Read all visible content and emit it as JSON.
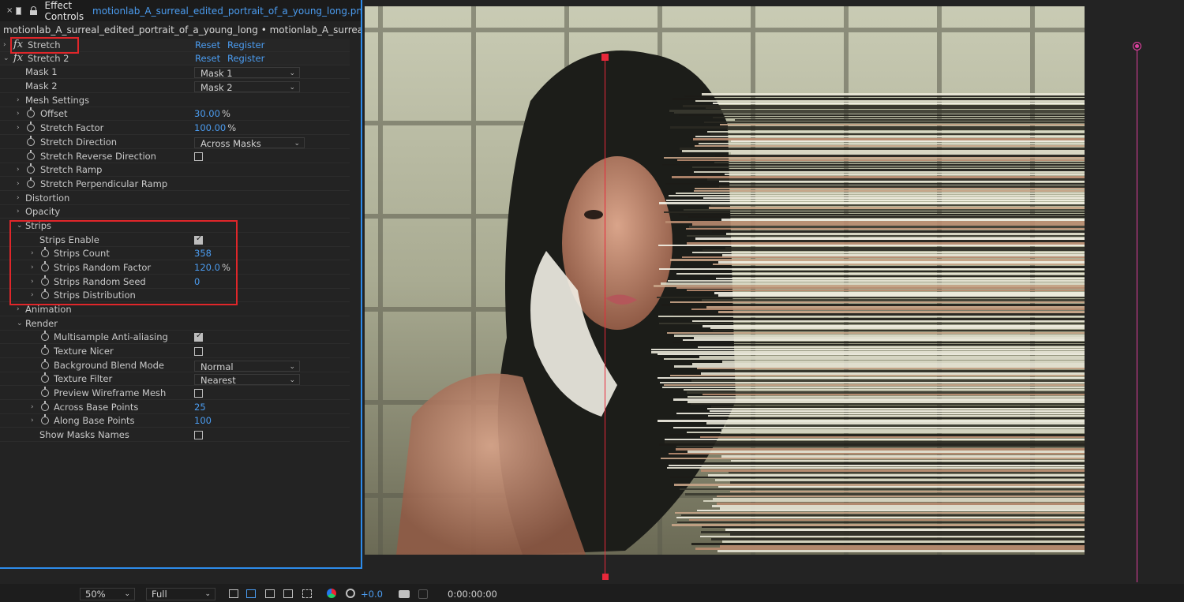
{
  "tab": {
    "close_glyph": "×",
    "title": "Effect Controls",
    "file": "motionlab_A_surreal_edited_portrait_of_a_young_long.pn"
  },
  "breadcrumb": "motionlab_A_surreal_edited_portrait_of_a_young_long • motionlab_A_surreal_edited_po",
  "effects": [
    {
      "name": "Stretch",
      "reset": "Reset",
      "register": "Register"
    },
    {
      "name": "Stretch 2",
      "reset": "Reset",
      "register": "Register"
    }
  ],
  "props": {
    "mask1": {
      "label": "Mask 1",
      "value": "Mask 1"
    },
    "mask2": {
      "label": "Mask 2",
      "value": "Mask 2"
    },
    "mesh_settings": "Mesh Settings",
    "offset": {
      "label": "Offset",
      "value": "30.00",
      "unit": "%"
    },
    "stretch_factor": {
      "label": "Stretch Factor",
      "value": "100.00",
      "unit": "%"
    },
    "stretch_direction": {
      "label": "Stretch Direction",
      "value": "Across Masks"
    },
    "stretch_reverse": {
      "label": "Stretch Reverse Direction",
      "checked": false
    },
    "stretch_ramp": "Stretch Ramp",
    "stretch_perp_ramp": "Stretch Perpendicular Ramp",
    "distortion": "Distortion",
    "opacity": "Opacity",
    "strips": "Strips",
    "strips_enable": {
      "label": "Strips Enable",
      "checked": true
    },
    "strips_count": {
      "label": "Strips Count",
      "value": "358"
    },
    "strips_random_factor": {
      "label": "Strips Random Factor",
      "value": "120.0",
      "unit": "%"
    },
    "strips_random_seed": {
      "label": "Strips Random Seed",
      "value": "0"
    },
    "strips_distribution": "Strips Distribution",
    "animation": "Animation",
    "render": "Render",
    "multisample": {
      "label": "Multisample Anti-aliasing",
      "checked": true
    },
    "texture_nicer": {
      "label": "Texture Nicer",
      "checked": false
    },
    "bg_blend": {
      "label": "Background Blend Mode",
      "value": "Normal"
    },
    "texture_filter": {
      "label": "Texture Filter",
      "value": "Nearest"
    },
    "preview_wire": {
      "label": "Preview Wireframe Mesh",
      "checked": false
    },
    "across_base": {
      "label": "Across Base Points",
      "value": "25"
    },
    "along_base": {
      "label": "Along Base Points",
      "value": "100"
    },
    "show_masks": {
      "label": "Show Masks Names",
      "checked": false
    }
  },
  "viewer_bar": {
    "zoom": "50%",
    "resolution": "Full",
    "exposure": "+0.0",
    "timecode": "0:00:00:00"
  },
  "colors": {
    "accent": "#4b9cf0",
    "highlight": "#e0262a",
    "mask_line": "#e8283a",
    "layer_handle": "#e040a0"
  }
}
